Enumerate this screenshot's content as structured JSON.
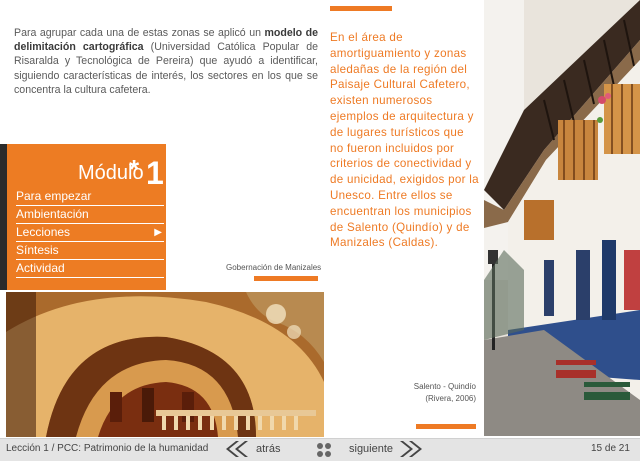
{
  "intro": {
    "text_before": "Para agrupar cada una de estas zonas se aplicó un ",
    "bold": "modelo de delimitación cartográfica",
    "text_after": " (Universidad Católica Popular de Risaralda y Tecnológica de Pereira) que ayudó a identificar, siguiendo características de interés, los sectores en los que se concentra la cultura cafetera."
  },
  "module": {
    "title": "Módulo",
    "star": "*",
    "number": "1",
    "menu": [
      {
        "label": "Para empezar"
      },
      {
        "label": "Ambientación"
      },
      {
        "label": "Lecciones"
      },
      {
        "label": "Síntesis"
      },
      {
        "label": "Actividad"
      }
    ]
  },
  "captions": {
    "gobernacion": "Gobernación de Manizales",
    "salento_line1": "Salento - Quindío",
    "salento_line2": "(Rivera, 2006)"
  },
  "quote": "En el área de amortiguamiento y zonas aledañas de la región del Paisaje Cultural Cafetero, existen numerosos ejemplos de arquitectura y de lugares turísticos que no fueron incluidos por criterios de conectividad y de unicidad, exigidos por la Unesco. Entre ellos se encuentran los municipios de Salento (Quindío) y de Manizales (Caldas).",
  "footer": {
    "lesson": "Lección 1 / PCC: Patrimonio de la humanidad",
    "back": "atrás",
    "next": "siguiente",
    "page": "15 de 21"
  },
  "colors": {
    "accent": "#ee7a24"
  }
}
